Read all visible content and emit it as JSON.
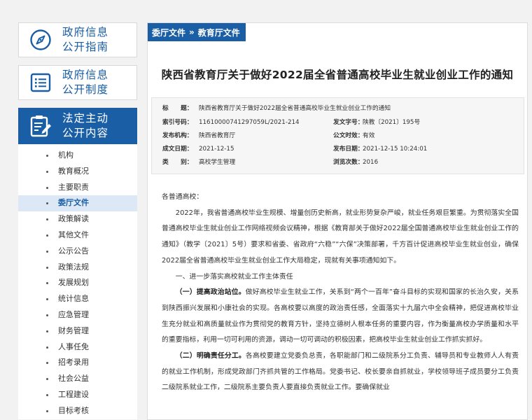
{
  "sidebar": {
    "cards": [
      {
        "label": "政府信息公开指南",
        "icon": "compass-icon"
      },
      {
        "label": "政府信息公开制度",
        "icon": "list-icon"
      },
      {
        "label": "法定主动公开内容",
        "icon": "clipboard-edit-icon"
      }
    ],
    "items": [
      "机构",
      "教育概况",
      "主要职责",
      "委厅文件",
      "政策解读",
      "其他文件",
      "公示公告",
      "政策法规",
      "发展规划",
      "统计信息",
      "应急管理",
      "财务管理",
      "人事任免",
      "招考录用",
      "社会公益",
      "工程建设",
      "目标考核"
    ],
    "current_item": "委厅文件"
  },
  "breadcrumb": {
    "item1": "委厅文件",
    "separator": "»",
    "item2": "教育厅文件"
  },
  "article": {
    "title": "陕西省教育厅关于做好2022届全省普通高校毕业生就业创业工作的通知",
    "meta": {
      "title_label": "标　　题：",
      "title_value": "陕西省教育厅关于做好2022届全省普通高校毕业生就业创业工作的通知",
      "index_label": "索引号码：",
      "index_value": "11610000741297059L/2021-214",
      "docno_label": "发文字号：",
      "docno_value": "陕教〔2021〕195号",
      "issuer_label": "发布机构：",
      "issuer_value": "陕西省教育厅",
      "validity_label": "公文时效：",
      "validity_value": "有效",
      "created_label": "成文日期：",
      "created_value": "2021-12-15",
      "published_label": "发布日期：",
      "published_value": "2021-12-15 10:24:01",
      "category_label": "类　　别：",
      "category_value": "高校学生管理",
      "views_label": "浏览次数：",
      "views_value": "2016"
    },
    "greeting": "各普通高校：",
    "para1": "2022年，我省普通高校毕业生规模、增量创历史新高，就业形势复杂严峻，就业任务艰巨繁重。为贯彻落实全国普通高校毕业生就业创业工作网络视频会议精神，根据《教育部关于做好2022届全国普通高校毕业生就业创业工作的通知》（教学〔2021〕5号）要求和省委、省政府“六稳”“六保”决策部署，千方百计促进高校毕业生就业创业，确保2022届全省普通高校毕业生就业创业工作大局稳定，现就有关事项通知如下。",
    "section1": "一、进一步落实高校就业工作主体责任",
    "p2_lead": "（一）提高政治站位。",
    "p2_text": "做好高校毕业生就业工作，关系到“两个一百年”奋斗目标的实现和国家的长治久安，关系到陕西振兴发展和小康社会的实现。各高校要以高度的政治责任感，全面落实十九届六中全会精神，把促进高校毕业生充分就业和高质量就业作为贯彻党的教育方针，坚持立德树人根本任务的重要内容，作为衡量高校办学质量和水平的重要指标，利用一切可利用的资源，调动一切可调动的积极因素，把高校毕业生就业创业工作抓实抓好。",
    "p3_lead": "（二）明确责任分工。",
    "p3_text": "各高校要建立党委负总责，各职能部门和二级院系分工负责、辅导员和专业教师人人有责的就业工作机制，形成党政部门齐抓共管的工作格局。党委书记、校长要亲自抓就业，学校领导班子成员要分工负责二级院系就业工作，二级院系主要负责人要直接负责就业工作。要确保就业"
  }
}
